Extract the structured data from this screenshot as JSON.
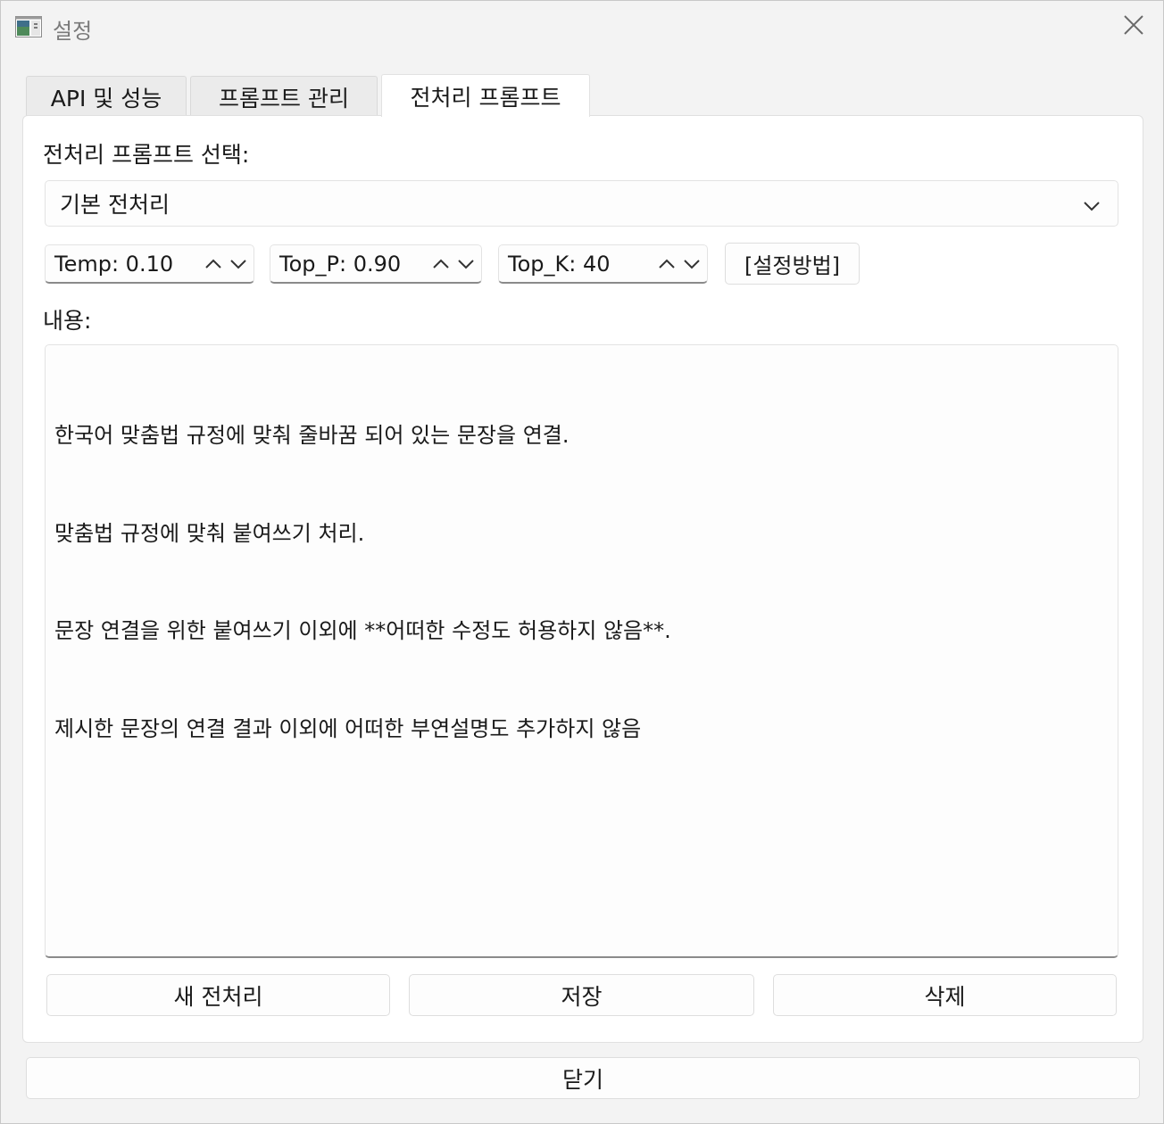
{
  "window": {
    "title": "설정"
  },
  "tabs": [
    {
      "label": "API 및 성능"
    },
    {
      "label": "프롬프트 관리"
    },
    {
      "label": "전처리 프롬프트"
    }
  ],
  "preprocess": {
    "select_label": "전처리 프롬프트 선택:",
    "selected_prompt": "기본 전처리",
    "temp": "Temp: 0.10",
    "top_p": "Top_P: 0.90",
    "top_k": "Top_K: 40",
    "guide_button": "[설정방법]",
    "content_label": "내용:",
    "content_lines": [
      "한국어 맞춤법 규정에 맞춰 줄바꿈 되어 있는 문장을 연결.",
      "맞춤법 규정에 맞춰 붙여쓰기 처리.",
      "문장 연결을 위한 붙여쓰기 이외에 **어떠한 수정도 허용하지 않음**.",
      "제시한 문장의 연결 결과 이외에 어떠한 부연설명도 추가하지 않음"
    ],
    "new_button": "새 전처리",
    "save_button": "저장",
    "delete_button": "삭제"
  },
  "footer": {
    "close_button": "닫기"
  },
  "icons": {
    "app": "app-window-icon",
    "close": "close-icon",
    "dropdown": "chevron-down-icon",
    "up": "chevron-up-icon",
    "down": "chevron-down-icon"
  }
}
